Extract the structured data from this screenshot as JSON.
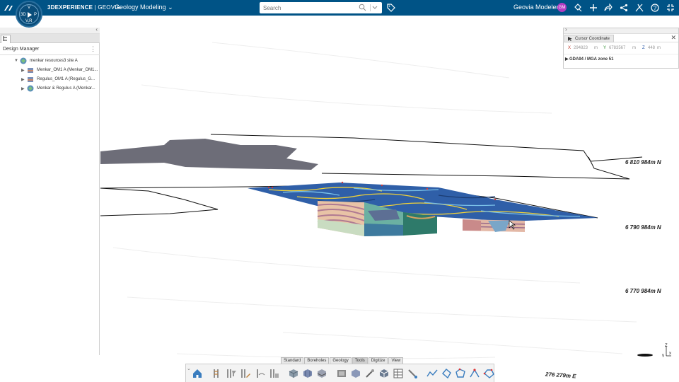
{
  "topbar": {
    "brand_main": "3DEXPERIENCE",
    "brand_sep": " | ",
    "brand_sub": "GEOVIA",
    "app_title": "Geology Modeling",
    "search_placeholder": "Search",
    "user_name": "Geovia Modeler",
    "user_initials": "GM",
    "compass_labels": {
      "top": "V",
      "left": "3D",
      "right": "P",
      "bottom": "V,R"
    }
  },
  "design_manager": {
    "title": "Design Manager",
    "tree": [
      {
        "label": "menkar resources3 site A",
        "level": 0,
        "expanded": true,
        "icon": "model-group-icon"
      },
      {
        "label": "Menkar_OM1 A (Menkar_OM1...",
        "level": 1,
        "expanded": false,
        "icon": "geology-model-icon"
      },
      {
        "label": "Regulus_OM1 A (Regulus_G...",
        "level": 1,
        "expanded": false,
        "icon": "geology-model-icon"
      },
      {
        "label": "Menkar & Regulus A (Menkar...",
        "level": 1,
        "expanded": false,
        "icon": "combined-model-icon"
      }
    ]
  },
  "cursor_coordinate": {
    "title": "Cursor Coordinate",
    "x_label": "X",
    "x_value": "294823",
    "x_unit": "m",
    "y_label": "Y",
    "y_value": "6783567",
    "y_unit": "m",
    "z_label": "Z",
    "z_value": "448",
    "z_unit": "m",
    "crs": "GDA94 / MGA zone 51"
  },
  "scene": {
    "northings": [
      "6 810 984m N",
      "6 790 984m N",
      "6 770 984m N"
    ],
    "easting": "276 279m E",
    "triad": {
      "z": "Z",
      "y": "y",
      "x": "x"
    }
  },
  "toolbar": {
    "tabs": [
      "Standard",
      "Boreholes",
      "Geology",
      "Tools",
      "Digitize",
      "View"
    ],
    "active_tab": "Tools",
    "buttons": [
      "home-icon",
      "borehole-icon",
      "borehole-filter-icon",
      "borehole-edit-icon",
      "borehole-trace-icon",
      "borehole-log-icon",
      "solid-model-icon",
      "block-model-icon",
      "grid-model-icon",
      "section-icon",
      "volume-icon",
      "probe-icon",
      "cube-icon",
      "table-icon",
      "pick-icon",
      "polyline-icon",
      "polygon-icon",
      "shape-icon",
      "vertex-edit-icon",
      "closed-polygon-icon"
    ]
  },
  "colors": {
    "topbar": "#005386",
    "accent": "#0a4d7a",
    "avatar": "#b23cc2"
  }
}
